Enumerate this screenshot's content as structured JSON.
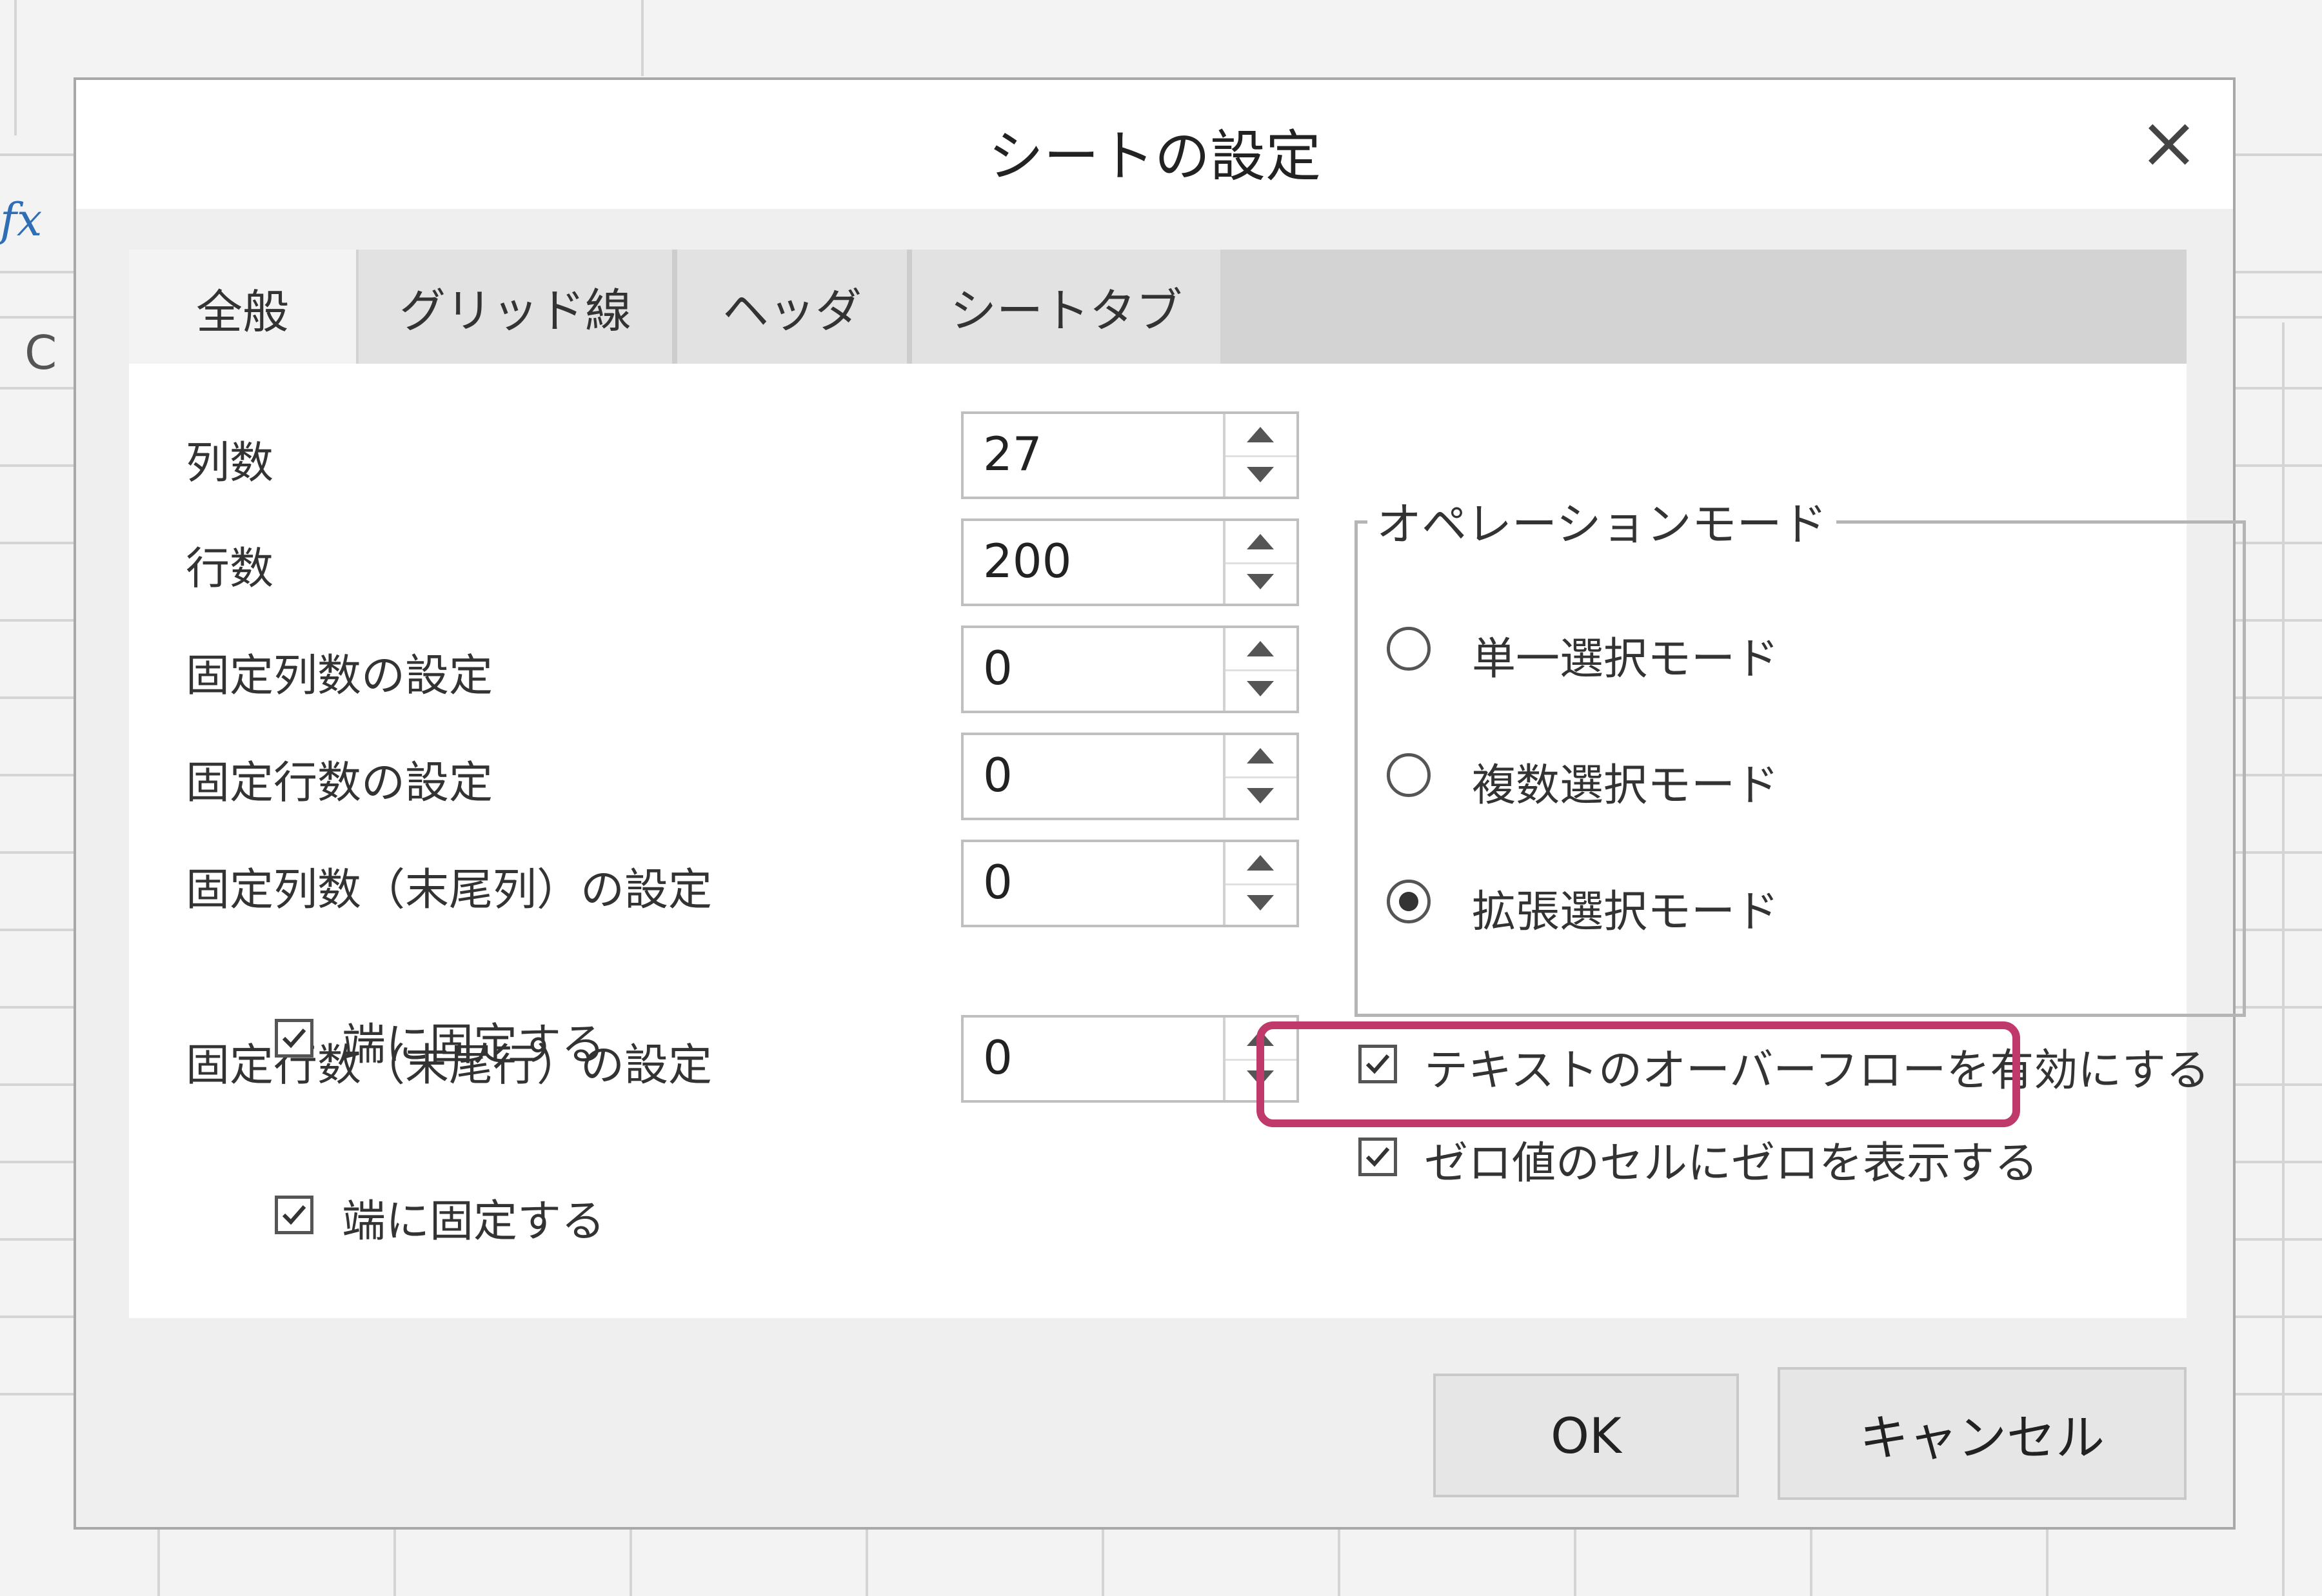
{
  "background": {
    "fx_label": "fx",
    "column_label": "C"
  },
  "dialog": {
    "title": "シートの設定",
    "tabs": [
      "全般",
      "グリッド線",
      "ヘッダ",
      "シートタブ"
    ],
    "active_tab": "全般",
    "fields": [
      {
        "label": "列数",
        "value": "27"
      },
      {
        "label": "行数",
        "value": "200"
      },
      {
        "label": "固定列数の設定",
        "value": "0"
      },
      {
        "label": "固定行数の設定",
        "value": "0"
      },
      {
        "label": "固定列数（末尾列）の設定",
        "value": "0"
      },
      {
        "label": "固定行数（末尾行）の設定",
        "value": "0"
      }
    ],
    "pin_to_edge_cols": {
      "label": "端に固定する",
      "checked": true
    },
    "pin_to_edge_rows": {
      "label": "端に固定する",
      "checked": true
    },
    "operation_mode": {
      "legend": "オペレーションモード",
      "options": [
        {
          "label": "単一選択モード",
          "selected": false
        },
        {
          "label": "複数選択モード",
          "selected": false
        },
        {
          "label": "拡張選択モード",
          "selected": true
        }
      ]
    },
    "text_overflow": {
      "label": "テキストのオーバーフローを有効にする",
      "checked": true
    },
    "show_zero": {
      "label": "ゼロ値のセルにゼロを表示する",
      "checked": true
    },
    "buttons": {
      "ok": "OK",
      "cancel": "キャンセル"
    }
  },
  "colors": {
    "highlight": "#c0396b",
    "fx_blue": "#2f6db5"
  }
}
